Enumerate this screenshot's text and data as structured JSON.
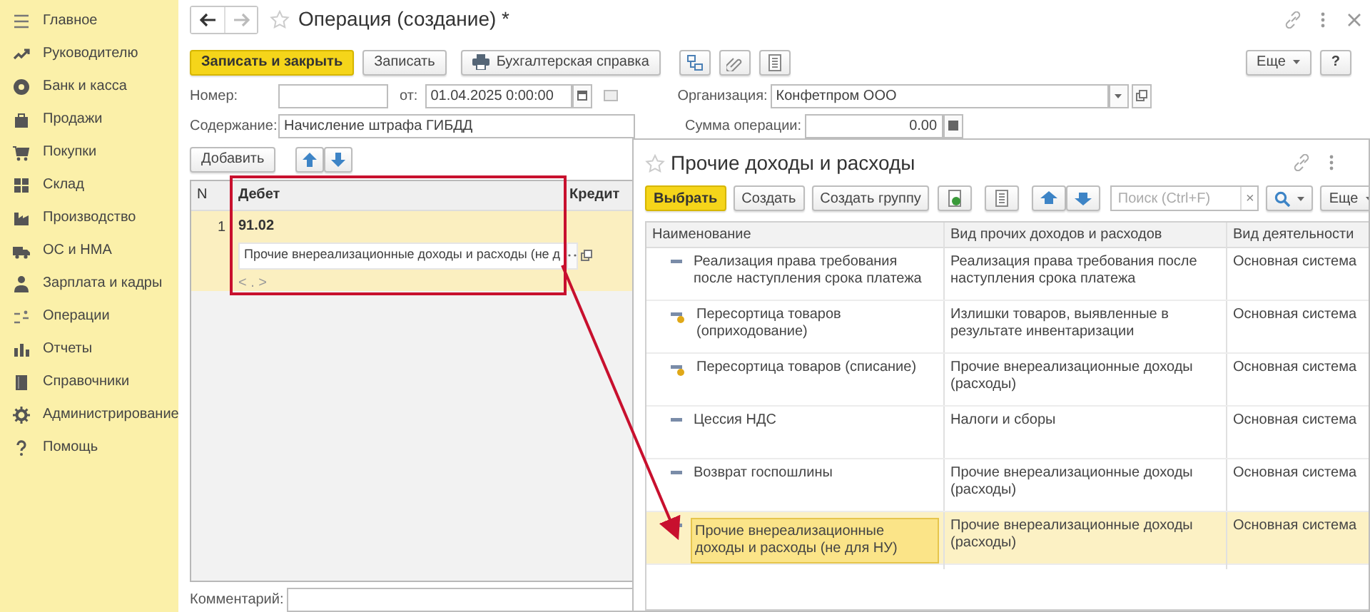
{
  "sidebar": {
    "items": [
      {
        "label": "Главное"
      },
      {
        "label": "Руководителю"
      },
      {
        "label": "Банк и касса"
      },
      {
        "label": "Продажи"
      },
      {
        "label": "Покупки"
      },
      {
        "label": "Склад"
      },
      {
        "label": "Производство"
      },
      {
        "label": "ОС и НМА"
      },
      {
        "label": "Зарплата и кадры"
      },
      {
        "label": "Операции"
      },
      {
        "label": "Отчеты"
      },
      {
        "label": "Справочники"
      },
      {
        "label": "Администрирование"
      },
      {
        "label": "Помощь"
      }
    ]
  },
  "form": {
    "title": "Операция (создание) *",
    "buttons": [
      {
        "label": "Записать и закрыть",
        "kind": "primary"
      },
      {
        "label": "Записать",
        "kind": "plain"
      },
      {
        "label": "Бухгалтерская справка",
        "kind": "print"
      }
    ],
    "more": "Еще",
    "help": "?",
    "number_label": "Номер:",
    "date_label": "от:",
    "date_value": "01.04.2025  0:00:00",
    "org_label": "Организация:",
    "org_value": "Конфетпром ООО",
    "content_label": "Содержание:",
    "content_value": "Начисление штрафа ГИБДД",
    "sum_label": "Сумма операции:",
    "sum_value": "0.00",
    "add_button": "Добавить",
    "table": {
      "columns": [
        "N",
        "Дебет",
        "Кредит"
      ],
      "rows": [
        {
          "n": "1",
          "account": "91.02",
          "subconto": "Прочие внереализационные доходы и расходы (не д",
          "extra": "< . >",
          "selected": true
        }
      ]
    },
    "comment_label": "Комментарий:"
  },
  "popup": {
    "title": "Прочие доходы и расходы",
    "buttons": [
      {
        "label": "Выбрать",
        "kind": "primary"
      },
      {
        "label": "Создать",
        "kind": "plain"
      },
      {
        "label": "Создать группу",
        "kind": "plain"
      }
    ],
    "search_placeholder": "Поиск (Ctrl+F)",
    "clear": "×",
    "more": "Еще",
    "table": {
      "columns": [
        "Наименование",
        "Вид прочих доходов и расходов",
        "Вид деятельности"
      ],
      "rows": [
        {
          "kind": "dash",
          "name": "Реализация права требования после наступления срока платежа",
          "type": "Реализация права требования после наступления срока платежа",
          "activity": "Основная система",
          "selected": false
        },
        {
          "kind": "dash-dot",
          "name": "Пересортица товаров (оприходование)",
          "type": "Излишки товаров, выявленные в результате инвентаризации",
          "activity": "Основная система",
          "selected": false
        },
        {
          "kind": "dash-dot",
          "name": "Пересортица товаров (списание)",
          "type": "Прочие внереализационные доходы (расходы)",
          "activity": "Основная система",
          "selected": false
        },
        {
          "kind": "dash",
          "name": "Цессия НДС",
          "type": "Налоги и сборы",
          "activity": "Основная система",
          "selected": false
        },
        {
          "kind": "dash",
          "name": "Возврат госпошлины",
          "type": "Прочие внереализационные доходы (расходы)",
          "activity": "Основная система",
          "selected": false
        },
        {
          "kind": "dash",
          "name": "Прочие внереализационные доходы и расходы (не для НУ)",
          "type": "Прочие внереализационные доходы (расходы)",
          "activity": "Основная система",
          "selected": true
        }
      ]
    }
  }
}
